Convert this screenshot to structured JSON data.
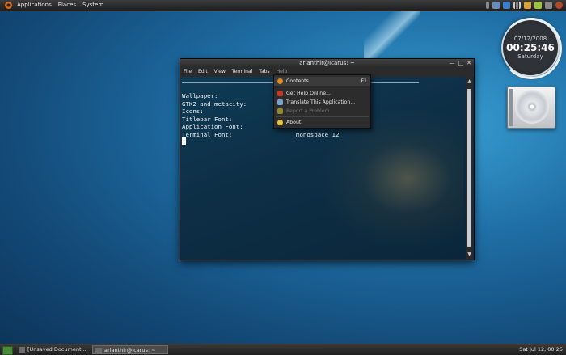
{
  "top_panel": {
    "menus": [
      "Applications",
      "Places",
      "System"
    ]
  },
  "clock_widget": {
    "date": "07/12/2008",
    "time": "00:25:46",
    "day": "Saturday"
  },
  "terminal": {
    "title": "arlanthir@Icarus: ~",
    "menus": [
      "File",
      "Edit",
      "View",
      "Terminal",
      "Tabs",
      "Help"
    ],
    "lines": [
      {
        "label": "Wallpaper:",
        "value": ""
      },
      {
        "label": "GTK2 and metacity:",
        "value": ""
      },
      {
        "label": "Icons:",
        "value": ""
      },
      {
        "label": "Titlebar Font:",
        "value": ""
      },
      {
        "label": "Application Font:",
        "value": ""
      },
      {
        "label": "Terminal Font:",
        "value": "monospace 12"
      }
    ]
  },
  "help_menu": {
    "items": [
      {
        "label": "Contents",
        "accel": "F1",
        "icon": "help-icon"
      },
      {
        "label": "Get Help Online...",
        "icon": "help-online-icon"
      },
      {
        "label": "Translate This Application...",
        "icon": "translate-icon"
      },
      {
        "label": "Report a Problem",
        "icon": "bug-icon"
      },
      {
        "label": "About",
        "icon": "about-icon"
      }
    ]
  },
  "taskbar": {
    "tasks": [
      "[Unsaved Document ...",
      "arlanthir@Icarus: ~"
    ],
    "clock": "Sat Jul 12, 00:25"
  },
  "colors": {
    "accent": "#d86a1c",
    "desktop": "#1f6fa6"
  }
}
